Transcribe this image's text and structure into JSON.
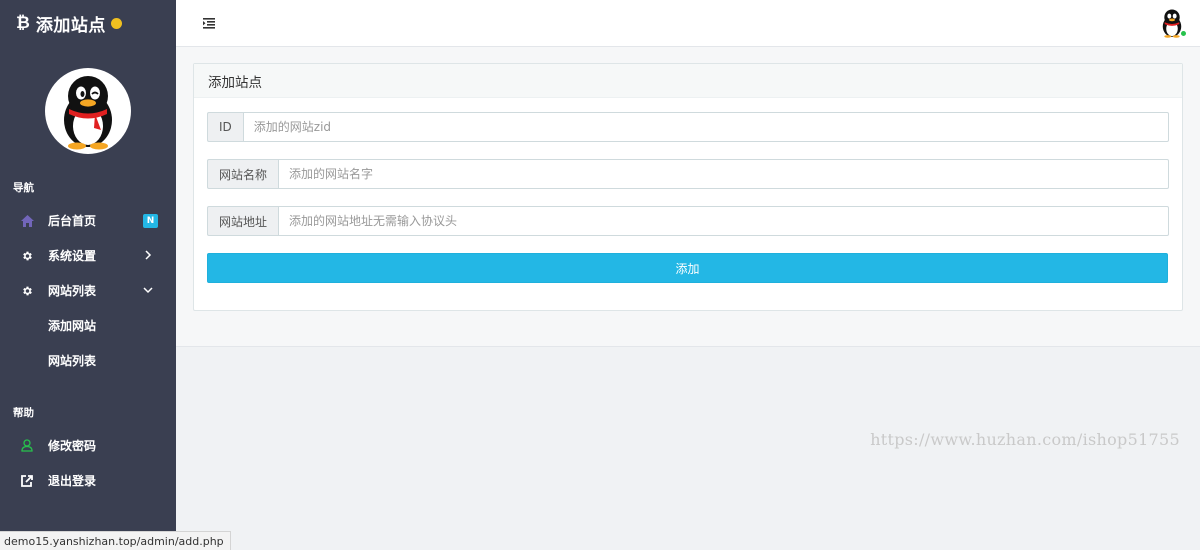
{
  "brand": {
    "icon": "₿",
    "title": "添加站点"
  },
  "sidebar": {
    "section_nav": "导航",
    "items": [
      {
        "label": "后台首页",
        "icon": "home-icon",
        "badge": "N"
      },
      {
        "label": "系统设置",
        "icon": "gear-icon",
        "chevron": "right"
      },
      {
        "label": "网站列表",
        "icon": "gear-icon",
        "chevron": "down"
      }
    ],
    "subitems": [
      {
        "label": "添加网站"
      },
      {
        "label": "网站列表"
      }
    ],
    "section_help": "帮助",
    "help_items": [
      {
        "label": "修改密码",
        "icon": "user-icon"
      },
      {
        "label": "退出登录",
        "icon": "sign-out-icon"
      }
    ]
  },
  "panel": {
    "title": "添加站点",
    "fields": [
      {
        "label": "ID",
        "placeholder": "添加的网站zid"
      },
      {
        "label": "网站名称",
        "placeholder": "添加的网站名字"
      },
      {
        "label": "网站地址",
        "placeholder": "添加的网站地址无需输入协议头"
      }
    ],
    "submit_label": "添加"
  },
  "watermark": "https://www.huzhan.com/ishop51755",
  "status_url": "demo15.yanshizhan.top/admin/add.php",
  "colors": {
    "sidebar_bg": "#3a3f51",
    "accent": "#23b7e5",
    "home_icon": "#7266ba",
    "user_icon": "#27c24c",
    "online": "#27c24c"
  }
}
